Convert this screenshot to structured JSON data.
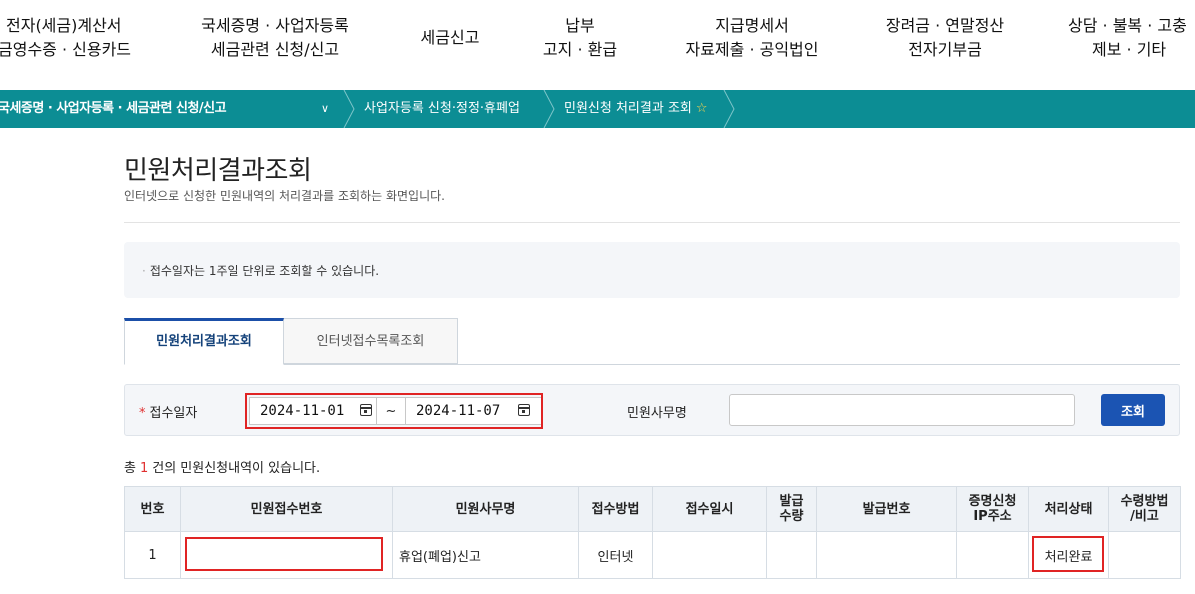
{
  "nav": [
    {
      "line1": "전자(세금)계산서",
      "line2": "금영수증 · 신용카드"
    },
    {
      "line1": "국세증명 · 사업자등록",
      "line2": "세금관련 신청/신고"
    },
    {
      "line1": "세금신고",
      "line2": ""
    },
    {
      "line1": "납부",
      "line2": "고지 · 환급"
    },
    {
      "line1": "지급명세서",
      "line2": "자료제출 · 공익법인"
    },
    {
      "line1": "장려금 · 연말정산",
      "line2": "전자기부금"
    },
    {
      "line1": "상담 · 불복 · 고충",
      "line2": "제보 · 기타"
    }
  ],
  "breadcrumb": {
    "main": "국세증명 · 사업자등록 · 세금관련 신청/신고",
    "item2": "사업자등록 신청·정정·휴폐업",
    "item3": "민원신청 처리결과 조회"
  },
  "page": {
    "title": "민원처리결과조회",
    "subtitle": "인터넷으로 신청한 민원내역의 처리결과를 조회하는 화면입니다.",
    "notice": "접수일자는 1주일 단위로 조회할 수 있습니다."
  },
  "tabs": [
    {
      "label": "민원처리결과조회",
      "active": true
    },
    {
      "label": "인터넷접수목록조회",
      "active": false
    }
  ],
  "search": {
    "required_mark": "*",
    "date_label": "접수일자",
    "date_from": "2024-11-01",
    "date_sep": "~",
    "date_to": "2024-11-07",
    "name_label": "민원사무명",
    "name_value": "",
    "button": "조회"
  },
  "count": {
    "prefix": "총",
    "num": "1",
    "suffix": "건의 민원신청내역이 있습니다."
  },
  "table": {
    "headers": [
      "번호",
      "민원접수번호",
      "민원사무명",
      "접수방법",
      "접수일시",
      "발급\n수량",
      "발급번호",
      "증명신청\nIP주소",
      "처리상태",
      "수령방법\n/비고"
    ],
    "rows": [
      [
        "1",
        "",
        "휴업(폐업)신고",
        "인터넷",
        "",
        "",
        "",
        "",
        "처리완료",
        ""
      ]
    ]
  },
  "colors": {
    "accent": "#0c8d94",
    "button": "#1b54b3",
    "highlight": "#e02424"
  }
}
